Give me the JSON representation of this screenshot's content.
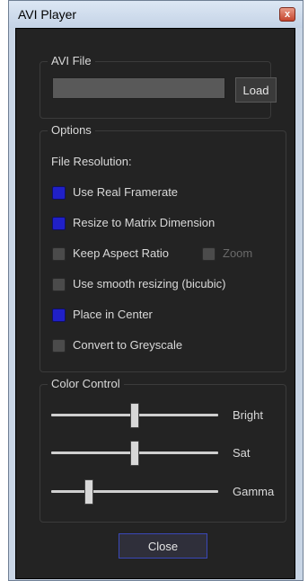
{
  "window": {
    "title": "AVI Player",
    "close_glyph": "x"
  },
  "avi_file": {
    "legend": "AVI File",
    "path_value": "",
    "load_label": "Load"
  },
  "options": {
    "legend": "Options",
    "file_resolution_label": "File Resolution:",
    "use_real_framerate": {
      "label": "Use Real Framerate",
      "checked": true
    },
    "resize_to_matrix": {
      "label": "Resize to Matrix Dimension",
      "checked": true
    },
    "keep_aspect_ratio": {
      "label": "Keep Aspect Ratio",
      "checked": false
    },
    "zoom": {
      "label": "Zoom",
      "checked": false,
      "enabled": false
    },
    "smooth_resizing": {
      "label": "Use smooth resizing (bicubic)",
      "checked": false
    },
    "place_in_center": {
      "label": "Place in Center",
      "checked": true
    },
    "greyscale": {
      "label": "Convert to Greyscale",
      "checked": false
    }
  },
  "color_control": {
    "legend": "Color Control",
    "bright": {
      "label": "Bright",
      "value": 0.5
    },
    "sat": {
      "label": "Sat",
      "value": 0.5
    },
    "gamma": {
      "label": "Gamma",
      "value": 0.21
    }
  },
  "footer": {
    "close_label": "Close"
  },
  "colors": {
    "checkbox_on": "#2020c8",
    "panel_bg": "#232323"
  }
}
